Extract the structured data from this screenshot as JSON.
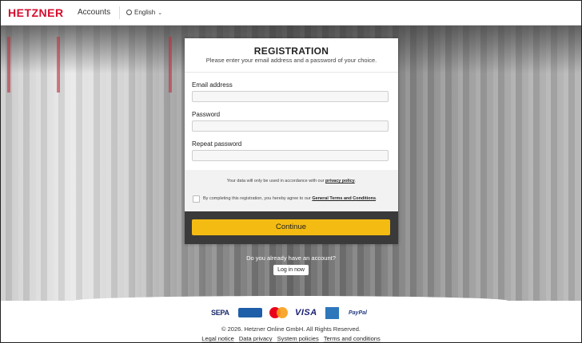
{
  "header": {
    "logo_text": "HETZNER",
    "app_name": "Accounts",
    "language": "English"
  },
  "form": {
    "title": "REGISTRATION",
    "subtitle": "Please enter your email address and a password of your choice.",
    "email_label": "Email address",
    "email_value": "",
    "password_label": "Password",
    "password_value": "",
    "repeat_label": "Repeat password",
    "repeat_value": "",
    "privacy_text": "Your data will only be used in accordance with our ",
    "privacy_link": "privacy policy",
    "privacy_end": ".",
    "terms_text": "By completing this registration, you hereby agree to our ",
    "terms_link": "General Terms and Conditions",
    "terms_end": ".",
    "terms_checked": false,
    "continue_label": "Continue"
  },
  "account": {
    "question": "Do you already have an account?",
    "login_label": "Log in now"
  },
  "payment_methods": [
    "SEPA",
    "Debit",
    "Mastercard",
    "VISA",
    "American Express",
    "PayPal"
  ],
  "footer": {
    "copyright": "© 2026. Hetzner Online GmbH. All Rights Reserved.",
    "links": [
      "Legal notice",
      "Data privacy",
      "System policies",
      "Terms and conditions"
    ]
  },
  "colors": {
    "brand": "#d50c2d",
    "button": "#f4bb12"
  }
}
